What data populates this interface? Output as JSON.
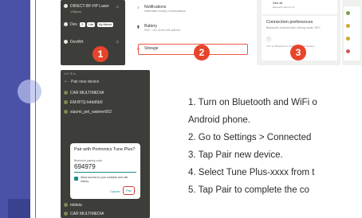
{
  "shot1": {
    "devices": [
      {
        "name": "DIRECT-BF-HP Laser",
        "sub": "138pnw"
      },
      {
        "name": "Dev",
        "chips": [
          "S",
          "Like",
          "My Merkst"
        ]
      },
      {
        "name": "DevWrt"
      }
    ],
    "badge": "1"
  },
  "shot2": {
    "settings": [
      {
        "title": "Notifications",
        "sub": "Notification history, conversations"
      },
      {
        "title": "Battery",
        "sub": "94% - 11h, 8 min left until full"
      },
      {
        "title": "Storage",
        "sub": ""
      }
    ],
    "badge": "2"
  },
  "shot3": {
    "see_all": "See all",
    "see_all_sub": "Bluetooth will turn on",
    "connection_title": "Connection preferences",
    "connection_sub": "Bluetooth, Android Auto, driving mode, NFC",
    "footer": "Turn on Bluetooth to connect to other devices",
    "badge": "3"
  },
  "shot5": {
    "status": "9:37 ☰ ⊕",
    "header": "Pair new device",
    "devices": [
      "CAR MULTIMEDIA",
      "EM-BTQ-b4dd5b0",
      "xiaomi_pet_waterer002",
      "",
      "",
      "",
      "mideia",
      "CAR MULTIMEDIA"
    ],
    "dialog": {
      "title": "Pair with Portronics Tune Plus?",
      "code_label": "Bluetooth pairing code",
      "code": "694979",
      "checkbox_label": "Allow access to your contacts and call history",
      "cancel": "Cancel",
      "pair": "Pair"
    }
  },
  "steps": [
    "1.  Turn on Bluetooth and WiFi o",
    "Android phone.",
    "2. Go to Settings > Connected",
    "3. Tap Pair new device.",
    "4. Select Tune Plus-xxxx from t",
    "5. Tap Pair to complete the co"
  ],
  "colors": {
    "accent": "#d23a78",
    "badge": "#e8442a",
    "left_strip": "#4a52a8"
  }
}
